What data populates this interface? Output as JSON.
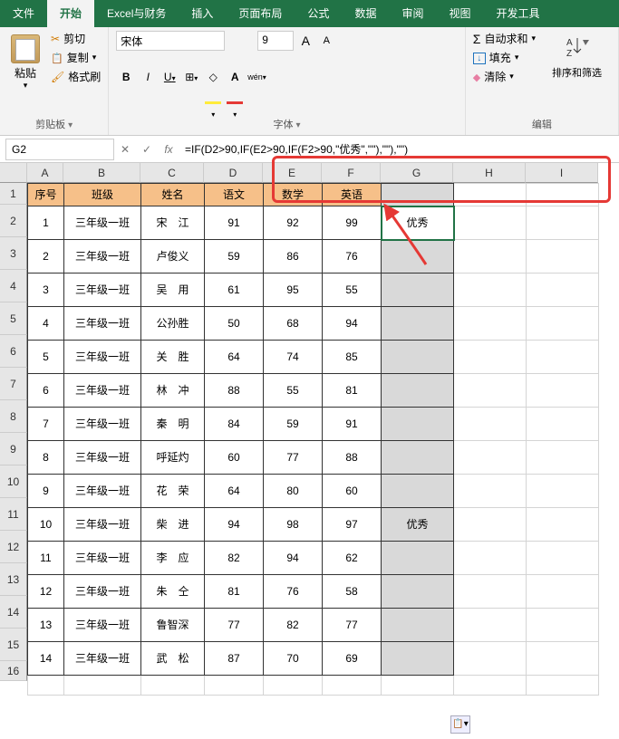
{
  "tabs": [
    "文件",
    "开始",
    "Excel与财务",
    "插入",
    "页面布局",
    "公式",
    "数据",
    "审阅",
    "视图",
    "开发工具"
  ],
  "active_tab": 1,
  "clipboard": {
    "paste": "粘贴",
    "cut": "剪切",
    "copy": "复制",
    "brush": "格式刷",
    "label": "剪贴板"
  },
  "font": {
    "name": "宋体",
    "size": "9",
    "grow": "A",
    "shrink": "A",
    "bold": "B",
    "italic": "I",
    "underline": "U",
    "wen": "wén",
    "label": "字体"
  },
  "editing": {
    "sum": "自动求和",
    "fill": "填充",
    "clear": "清除",
    "sort": "排序和筛选",
    "label": "编辑"
  },
  "name_box": "G2",
  "formula": "=IF(D2>90,IF(E2>90,IF(F2>90,\"优秀\",\"\"),\"\"),\"\")",
  "columns": [
    "A",
    "B",
    "C",
    "D",
    "E",
    "F",
    "G",
    "H",
    "I"
  ],
  "row_nums": [
    "1",
    "2",
    "3",
    "4",
    "5",
    "6",
    "7",
    "8",
    "9",
    "10",
    "11",
    "12",
    "13",
    "14",
    "15",
    "16"
  ],
  "headers": [
    "序号",
    "班级",
    "姓名",
    "语文",
    "数学",
    "英语"
  ],
  "rows": [
    {
      "n": "1",
      "cls": "三年级一班",
      "name": "宋　江",
      "a": "91",
      "b": "92",
      "c": "99",
      "r": "优秀"
    },
    {
      "n": "2",
      "cls": "三年级一班",
      "name": "卢俊义",
      "a": "59",
      "b": "86",
      "c": "76",
      "r": ""
    },
    {
      "n": "3",
      "cls": "三年级一班",
      "name": "吴　用",
      "a": "61",
      "b": "95",
      "c": "55",
      "r": ""
    },
    {
      "n": "4",
      "cls": "三年级一班",
      "name": "公孙胜",
      "a": "50",
      "b": "68",
      "c": "94",
      "r": ""
    },
    {
      "n": "5",
      "cls": "三年级一班",
      "name": "关　胜",
      "a": "64",
      "b": "74",
      "c": "85",
      "r": ""
    },
    {
      "n": "6",
      "cls": "三年级一班",
      "name": "林　冲",
      "a": "88",
      "b": "55",
      "c": "81",
      "r": ""
    },
    {
      "n": "7",
      "cls": "三年级一班",
      "name": "秦　明",
      "a": "84",
      "b": "59",
      "c": "91",
      "r": ""
    },
    {
      "n": "8",
      "cls": "三年级一班",
      "name": "呼延灼",
      "a": "60",
      "b": "77",
      "c": "88",
      "r": ""
    },
    {
      "n": "9",
      "cls": "三年级一班",
      "name": "花　荣",
      "a": "64",
      "b": "80",
      "c": "60",
      "r": ""
    },
    {
      "n": "10",
      "cls": "三年级一班",
      "name": "柴　进",
      "a": "94",
      "b": "98",
      "c": "97",
      "r": "优秀"
    },
    {
      "n": "11",
      "cls": "三年级一班",
      "name": "李　应",
      "a": "82",
      "b": "94",
      "c": "62",
      "r": ""
    },
    {
      "n": "12",
      "cls": "三年级一班",
      "name": "朱　仝",
      "a": "81",
      "b": "76",
      "c": "58",
      "r": ""
    },
    {
      "n": "13",
      "cls": "三年级一班",
      "name": "鲁智深",
      "a": "77",
      "b": "82",
      "c": "77",
      "r": ""
    },
    {
      "n": "14",
      "cls": "三年级一班",
      "name": "武　松",
      "a": "87",
      "b": "70",
      "c": "69",
      "r": ""
    }
  ]
}
